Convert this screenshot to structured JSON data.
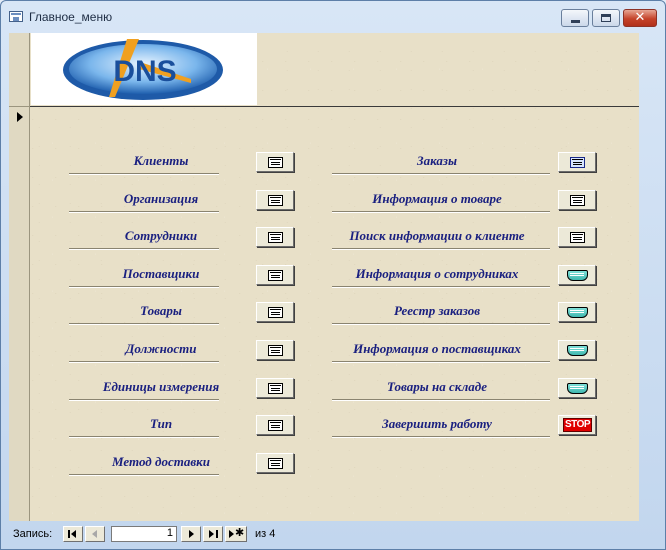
{
  "window": {
    "title": "Главное_меню"
  },
  "logo": {
    "text": "DNS"
  },
  "menu_left": [
    {
      "label": "Клиенты",
      "icon": "form"
    },
    {
      "label": "Организация",
      "icon": "form"
    },
    {
      "label": "Сотрудники",
      "icon": "form"
    },
    {
      "label": "Поставщики",
      "icon": "form"
    },
    {
      "label": "Товары",
      "icon": "form"
    },
    {
      "label": "Должности",
      "icon": "form"
    },
    {
      "label": "Единицы измерения",
      "icon": "form"
    },
    {
      "label": "Тип",
      "icon": "form"
    },
    {
      "label": "Метод доставки",
      "icon": "form"
    }
  ],
  "menu_right": [
    {
      "label": "Заказы",
      "icon": "form-blue"
    },
    {
      "label": "Информация о товаре",
      "icon": "form"
    },
    {
      "label": "Поиск информации о клиенте",
      "icon": "form"
    },
    {
      "label": "Информация о сотрудниках",
      "icon": "report"
    },
    {
      "label": "Реестр заказов",
      "icon": "report"
    },
    {
      "label": "Информация о поставщиках",
      "icon": "report"
    },
    {
      "label": "Товары на складе",
      "icon": "report"
    },
    {
      "label": "Завершить работу",
      "icon": "stop",
      "icon_text": "STOP"
    }
  ],
  "navigator": {
    "label": "Запись:",
    "current": "1",
    "of_label": "из",
    "total": "4"
  },
  "colors": {
    "label": "#1a2080",
    "background": "#e8e0c8",
    "stop": "#e00000"
  }
}
